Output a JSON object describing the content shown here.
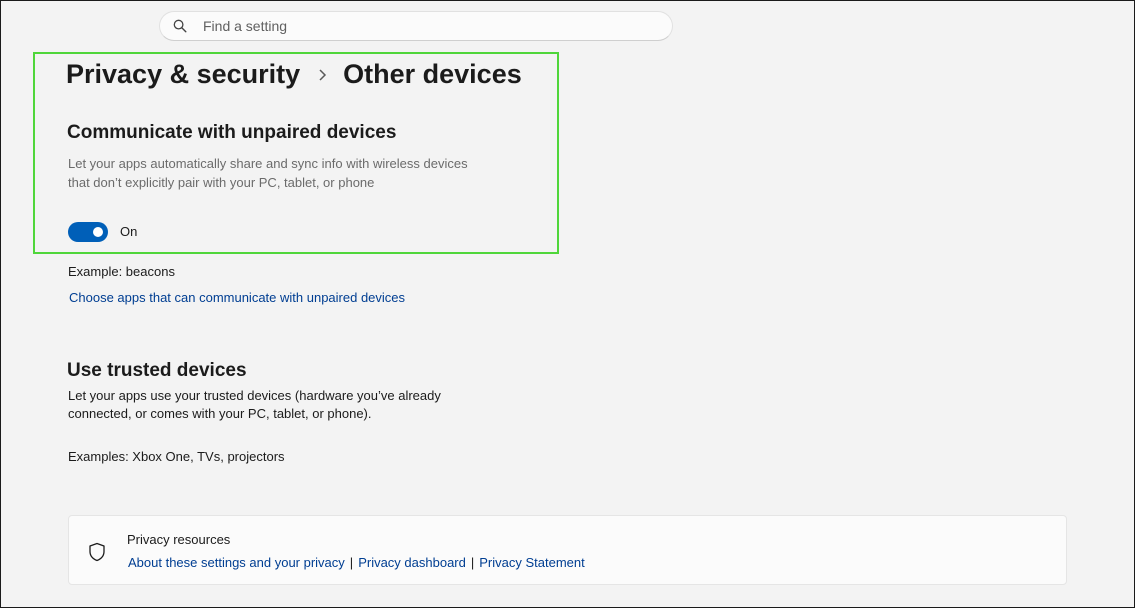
{
  "search": {
    "placeholder": "Find a setting"
  },
  "breadcrumb": {
    "parent": "Privacy & security",
    "current": "Other devices"
  },
  "unpaired": {
    "title": "Communicate with unpaired devices",
    "desc_line1": "Let your apps automatically share and sync info with wireless devices",
    "desc_line2": "that don’t explicitly pair with your PC, tablet, or phone",
    "toggle_state": "On",
    "example": "Example: beacons",
    "link": "Choose apps that can communicate with unpaired devices"
  },
  "trusted": {
    "title": "Use trusted devices",
    "desc_line1": "Let your apps use your trusted devices (hardware you’ve already",
    "desc_line2": "connected, or comes with your PC, tablet, or phone).",
    "examples": "Examples: Xbox One, TVs, projectors"
  },
  "resources": {
    "title": "Privacy resources",
    "link1": "About these settings and your privacy",
    "link2": "Privacy dashboard",
    "link3": "Privacy Statement",
    "separator": "|"
  },
  "colors": {
    "accent": "#005fb8",
    "link": "#003e92",
    "highlight": "#4fd63a"
  },
  "icons": {
    "search": "search-icon",
    "chevron": "chevron-right-icon",
    "shield": "shield-icon"
  }
}
